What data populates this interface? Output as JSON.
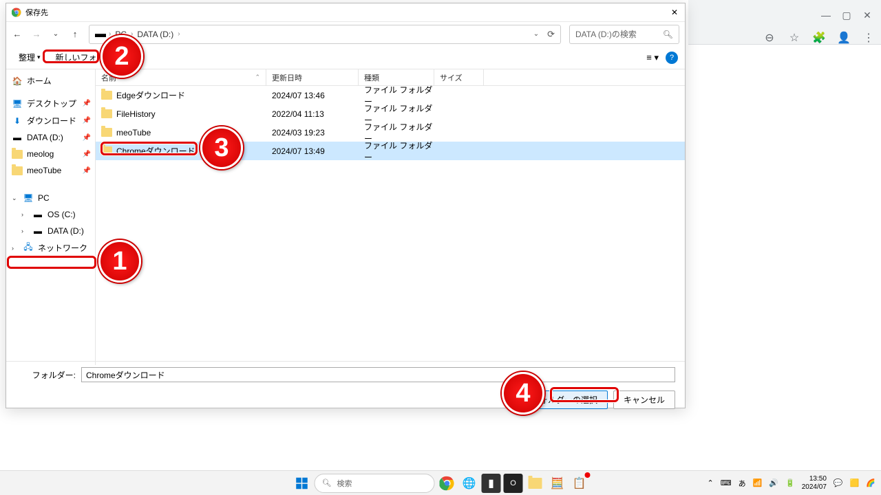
{
  "dialog": {
    "title": "保存先",
    "breadcrumb": {
      "drive_icon": "▬",
      "pc": "PC",
      "drive": "DATA (D:)"
    },
    "search_placeholder": "DATA (D:)の検索",
    "toolbar": {
      "organize": "整理",
      "new_folder": "新しいフォルダー"
    },
    "columns": {
      "name": "名前",
      "date": "更新日時",
      "type": "種類",
      "size": "サイズ"
    },
    "sidebar": {
      "home": "ホーム",
      "desktop": "デスクトップ",
      "downloads": "ダウンロード",
      "data_d": "DATA (D:)",
      "meolog": "meolog",
      "meotube": "meoTube",
      "pc": "PC",
      "os_c": "OS (C:)",
      "data_d2": "DATA (D:)",
      "network": "ネットワーク"
    },
    "files": [
      {
        "name": "Edgeダウンロード",
        "date": "2024/07 13:46",
        "type": "ファイル フォルダー"
      },
      {
        "name": "FileHistory",
        "date": "2022/04 11:13",
        "type": "ファイル フォルダー"
      },
      {
        "name": "meoTube",
        "date": "2024/03 19:23",
        "type": "ファイル フォルダー"
      },
      {
        "name": "Chromeダウンロード",
        "date": "2024/07 13:49",
        "type": "ファイル フォルダー"
      }
    ],
    "footer": {
      "folder_label": "フォルダー:",
      "folder_value": "Chromeダウンロード",
      "select_btn": "フォルダーの選択",
      "cancel_btn": "キャンセル"
    }
  },
  "taskbar": {
    "search": "検索",
    "time": "13:50",
    "date": "2024/07",
    "ime": "あ"
  }
}
